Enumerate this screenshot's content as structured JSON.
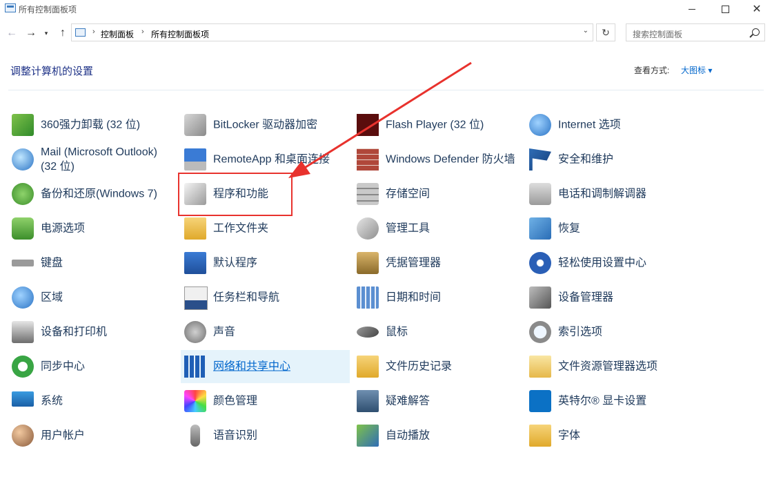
{
  "window": {
    "title": "所有控制面板项"
  },
  "address": {
    "crumbs": [
      "控制面板",
      "所有控制面板项"
    ]
  },
  "search": {
    "placeholder": "搜索控制面板"
  },
  "header": {
    "title": "调整计算机的设置",
    "view_by_label": "查看方式:",
    "view_by_value": "大图标 ▾"
  },
  "items": [
    {
      "label": "360强力卸载 (32 位)",
      "icon": "uninstall-icon"
    },
    {
      "label": "BitLocker 驱动器加密",
      "icon": "bitlocker-icon"
    },
    {
      "label": "Flash Player (32 位)",
      "icon": "flash-icon"
    },
    {
      "label": "Internet 选项",
      "icon": "internet-options-icon"
    },
    {
      "label": "Mail (Microsoft Outlook) (32 位)",
      "icon": "mail-icon"
    },
    {
      "label": "RemoteApp 和桌面连接",
      "icon": "remoteapp-icon"
    },
    {
      "label": "Windows Defender 防火墙",
      "icon": "firewall-icon"
    },
    {
      "label": "安全和维护",
      "icon": "flag-icon"
    },
    {
      "label": "备份和还原(Windows 7)",
      "icon": "backup-icon"
    },
    {
      "label": "程序和功能",
      "icon": "programs-icon"
    },
    {
      "label": "存储空间",
      "icon": "storage-icon"
    },
    {
      "label": "电话和调制解调器",
      "icon": "phone-icon"
    },
    {
      "label": "电源选项",
      "icon": "power-icon"
    },
    {
      "label": "工作文件夹",
      "icon": "work-folders-icon"
    },
    {
      "label": "管理工具",
      "icon": "admin-tools-icon"
    },
    {
      "label": "恢复",
      "icon": "recovery-icon"
    },
    {
      "label": "键盘",
      "icon": "keyboard-icon"
    },
    {
      "label": "默认程序",
      "icon": "default-programs-icon"
    },
    {
      "label": "凭据管理器",
      "icon": "credential-icon"
    },
    {
      "label": "轻松使用设置中心",
      "icon": "ease-of-access-icon"
    },
    {
      "label": "区域",
      "icon": "region-icon"
    },
    {
      "label": "任务栏和导航",
      "icon": "taskbar-icon"
    },
    {
      "label": "日期和时间",
      "icon": "calendar-icon"
    },
    {
      "label": "设备管理器",
      "icon": "device-manager-icon"
    },
    {
      "label": "设备和打印机",
      "icon": "printer-icon"
    },
    {
      "label": "声音",
      "icon": "speaker-icon"
    },
    {
      "label": "鼠标",
      "icon": "mouse-icon"
    },
    {
      "label": "索引选项",
      "icon": "index-icon"
    },
    {
      "label": "同步中心",
      "icon": "sync-icon"
    },
    {
      "label": "网络和共享中心",
      "icon": "network-icon"
    },
    {
      "label": "文件历史记录",
      "icon": "file-history-icon"
    },
    {
      "label": "文件资源管理器选项",
      "icon": "folder-options-icon"
    },
    {
      "label": "系统",
      "icon": "system-icon"
    },
    {
      "label": "颜色管理",
      "icon": "color-icon"
    },
    {
      "label": "疑难解答",
      "icon": "troubleshoot-icon"
    },
    {
      "label": "英特尔® 显卡设置",
      "icon": "intel-graphics-icon"
    },
    {
      "label": "用户帐户",
      "icon": "users-icon"
    },
    {
      "label": "语音识别",
      "icon": "microphone-icon"
    },
    {
      "label": "自动播放",
      "icon": "autoplay-icon"
    },
    {
      "label": "字体",
      "icon": "fonts-icon"
    }
  ],
  "annotation": {
    "color": "#e8322d"
  }
}
